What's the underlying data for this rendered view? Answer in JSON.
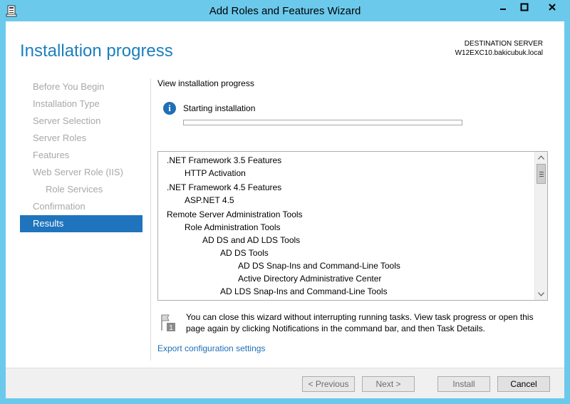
{
  "window": {
    "title": "Add Roles and Features Wizard",
    "min_glyph": "—",
    "max_glyph": "▢",
    "close_glyph": "✕",
    "frame_color": "#6bc9ec"
  },
  "header": {
    "title": "Installation progress",
    "destination_label": "DESTINATION SERVER",
    "destination_server": "W12EXC10.bakicubuk.local"
  },
  "nav": {
    "items": [
      {
        "label": "Before You Begin"
      },
      {
        "label": "Installation Type"
      },
      {
        "label": "Server Selection"
      },
      {
        "label": "Server Roles"
      },
      {
        "label": "Features"
      },
      {
        "label": "Web Server Role (IIS)"
      },
      {
        "label": "Role Services"
      },
      {
        "label": "Confirmation"
      },
      {
        "label": "Results"
      }
    ],
    "active": "Results"
  },
  "content": {
    "view_label": "View installation progress",
    "status_text": "Starting installation",
    "progress_fraction": 0.0,
    "features": [
      {
        "label": ".NET Framework 3.5 Features",
        "level": 0
      },
      {
        "label": "HTTP Activation",
        "level": 1
      },
      {
        "label": ".NET Framework 4.5 Features",
        "level": 0
      },
      {
        "label": "ASP.NET 4.5",
        "level": 1
      },
      {
        "label": "Remote Server Administration Tools",
        "level": 0
      },
      {
        "label": "Role Administration Tools",
        "level": 1
      },
      {
        "label": "AD DS and AD LDS Tools",
        "level": 2
      },
      {
        "label": "AD DS Tools",
        "level": 3
      },
      {
        "label": "AD DS Snap-Ins and Command-Line Tools",
        "level": 4
      },
      {
        "label": "Active Directory Administrative Center",
        "level": 4
      },
      {
        "label": "AD LDS Snap-Ins and Command-Line Tools",
        "level": 3
      }
    ],
    "notice_badge": "1",
    "notice": "You can close this wizard without interrupting running tasks. View task progress or open this page again by clicking Notifications in the command bar, and then Task Details.",
    "export_link": "Export configuration settings"
  },
  "footer": {
    "previous": "< Previous",
    "next": "Next >",
    "install": "Install",
    "cancel": "Cancel"
  },
  "colors": {
    "accent": "#1f74bd",
    "title_blue": "#1b7fbd",
    "disabled_text": "#a8a8a8"
  }
}
